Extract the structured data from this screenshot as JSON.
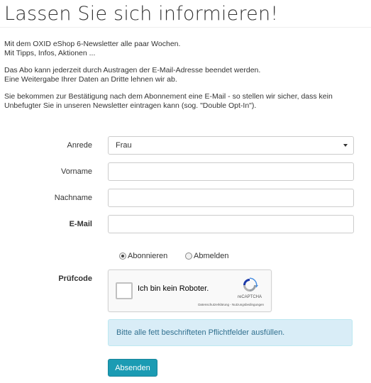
{
  "page": {
    "title": "Lassen Sie sich informieren!",
    "intro": [
      "Mit dem OXID eShop 6-Newsletter alle paar Wochen.",
      "Mit Tipps, Infos, Aktionen ...",
      "Das Abo kann jederzeit durch Austragen der E-Mail-Adresse beendet werden.",
      "Eine Weitergabe Ihrer Daten an Dritte lehnen wir ab.",
      "Sie bekommen zur Bestätigung nach dem Abonnement eine E-Mail - so stellen wir sicher, dass kein Unbefugter Sie in unseren Newsletter eintragen kann (sog. \"Double Opt-In\")."
    ]
  },
  "form": {
    "salutation": {
      "label": "Anrede",
      "value": "Frau",
      "icon": "caret-down-icon"
    },
    "firstname": {
      "label": "Vorname",
      "value": ""
    },
    "lastname": {
      "label": "Nachname",
      "value": ""
    },
    "email": {
      "label": "E-Mail",
      "value": ""
    },
    "subscribe": {
      "options": [
        {
          "label": "Abonnieren",
          "selected": true
        },
        {
          "label": "Abmelden",
          "selected": false
        }
      ]
    },
    "captcha": {
      "label": "Prüfcode",
      "checkbox_text": "Ich bin kein Roboter.",
      "brand": "reCAPTCHA",
      "terms": "Datenschutzerklärung - Nutzungsbedingungen",
      "icon": "recaptcha-logo-icon"
    },
    "hint": "Bitte alle fett beschrifteten Pflichtfelder ausfüllen.",
    "submit_label": "Absenden"
  },
  "colors": {
    "primary_button": "#1b9bb3",
    "info_background": "#d9edf7",
    "info_text": "#31708f"
  }
}
